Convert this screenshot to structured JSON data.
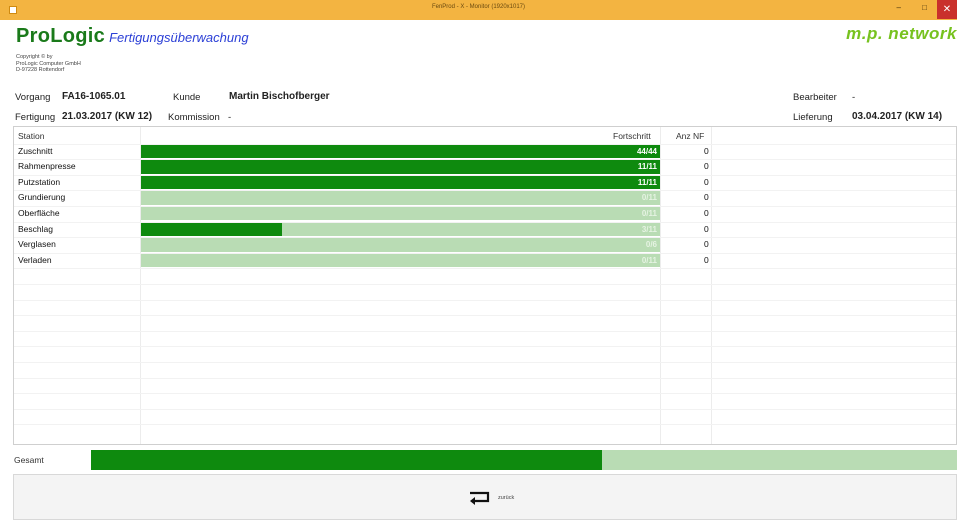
{
  "window": {
    "title": "FenProd - X - Monitor (1920x1017)",
    "controls": {
      "minimize": "–",
      "restore": "□",
      "close": "✕"
    }
  },
  "brand": {
    "name": "ProLogic",
    "subtitle": "Fertigungsüberwachung",
    "partner": "m.p. network"
  },
  "copyright": [
    "Copyright © by",
    "ProLogic Computer GmbH",
    "D-97228 Rottendorf"
  ],
  "order": {
    "vorgang_label": "Vorgang",
    "vorgang": "FA16-1065.01",
    "kunde_label": "Kunde",
    "kunde": "Martin Bischofberger",
    "bearbeiter_label": "Bearbeiter",
    "bearbeiter": "-",
    "fertigung_label": "Fertigung",
    "fertigung": "21.03.2017 (KW 12)",
    "kommission_label": "Kommission",
    "kommission": "-",
    "lieferung_label": "Lieferung",
    "lieferung": "03.04.2017 (KW 14)"
  },
  "table": {
    "headers": {
      "station": "Station",
      "fortschritt": "Fortschritt",
      "anz_nf": "Anz NF"
    },
    "rows": [
      {
        "station": "Zuschnitt",
        "progress_text": "44/44",
        "progress": 1.0,
        "anz_nf": "0"
      },
      {
        "station": "Rahmenpresse",
        "progress_text": "11/11",
        "progress": 1.0,
        "anz_nf": "0"
      },
      {
        "station": "Putzstation",
        "progress_text": "11/11",
        "progress": 1.0,
        "anz_nf": "0"
      },
      {
        "station": "Grundierung",
        "progress_text": "0/11",
        "progress": 0.0,
        "anz_nf": "0"
      },
      {
        "station": "Oberfläche",
        "progress_text": "0/11",
        "progress": 0.0,
        "anz_nf": "0"
      },
      {
        "station": "Beschlag",
        "progress_text": "3/11",
        "progress": 0.2727,
        "anz_nf": "0"
      },
      {
        "station": "Verglasen",
        "progress_text": "0/6",
        "progress": 0.0,
        "anz_nf": "0"
      },
      {
        "station": "Verladen",
        "progress_text": "0/11",
        "progress": 0.0,
        "anz_nf": "0"
      }
    ]
  },
  "total": {
    "label": "Gesamt",
    "progress": 0.59
  },
  "back_button": {
    "label": "zurück",
    "icon": "return-arrow-icon"
  },
  "colors": {
    "bar_fill": "#0e8a0e",
    "bar_track": "#b9dcb4",
    "titlebar": "#f3b441",
    "brand_green": "#1a7a1a",
    "subtitle_blue": "#2b3fd6",
    "partner_green": "#77c21f"
  }
}
